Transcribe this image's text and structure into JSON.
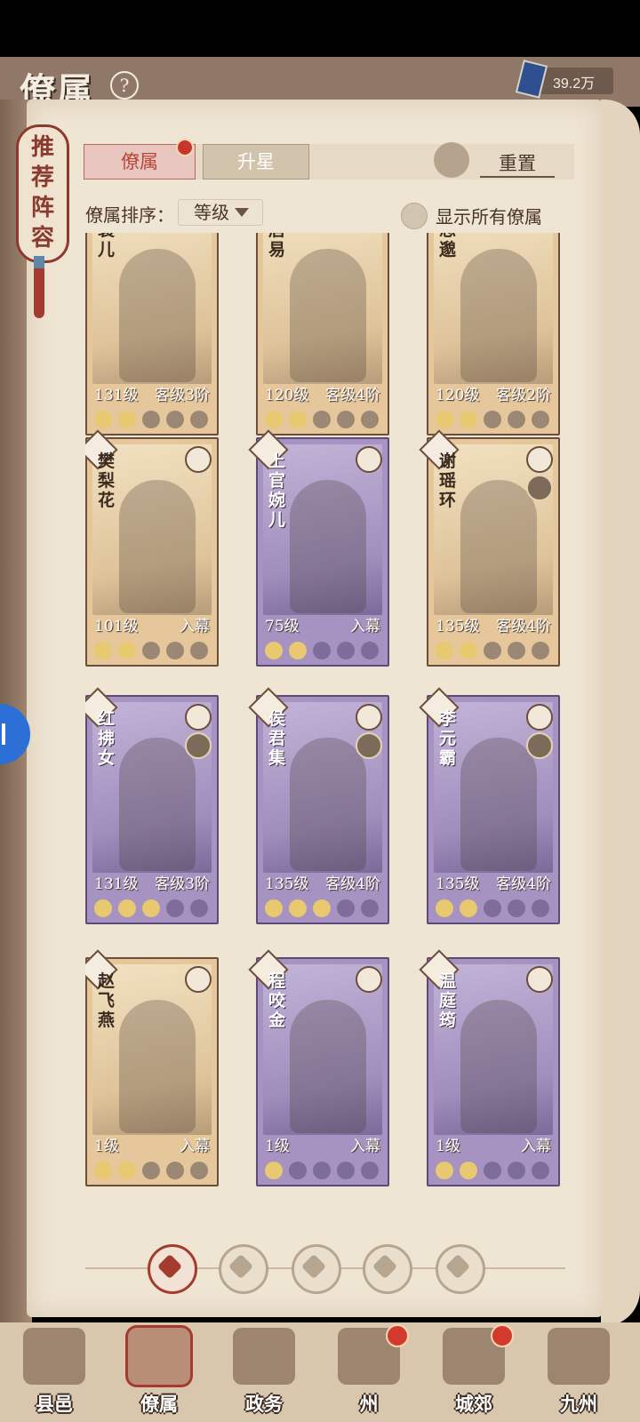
{
  "header": {
    "title": "僚属",
    "help_icon": "question-icon",
    "currency": "39.2万"
  },
  "recommend_tag": {
    "label": "推荐阵容"
  },
  "tabs": [
    {
      "label": "僚属",
      "active": true,
      "has_dot": true
    },
    {
      "label": "升星",
      "active": false
    }
  ],
  "reset": {
    "label": "重置",
    "icon": "refresh-icon"
  },
  "sort": {
    "label": "僚属排序：",
    "value": "等级"
  },
  "show_all": {
    "label": "显示所有僚属",
    "checked": false
  },
  "cards": [
    {
      "name": "襄儿",
      "level": "131级",
      "rank": "客级3阶",
      "moons": 2,
      "tier": "gold"
    },
    {
      "name": "居易",
      "level": "120级",
      "rank": "客级4阶",
      "moons": 2,
      "tier": "gold"
    },
    {
      "name": "思邈",
      "level": "120级",
      "rank": "客级2阶",
      "moons": 2,
      "tier": "gold"
    },
    {
      "name": "樊梨花",
      "level": "101级",
      "rank": "入幕",
      "moons": 2,
      "tier": "gold"
    },
    {
      "name": "上官婉儿",
      "level": "75级",
      "rank": "入幕",
      "moons": 2,
      "tier": "purple"
    },
    {
      "name": "谢瑶环",
      "level": "135级",
      "rank": "客级4阶",
      "moons": 2,
      "tier": "gold"
    },
    {
      "name": "红拂女",
      "level": "131级",
      "rank": "客级3阶",
      "moons": 3,
      "tier": "purple"
    },
    {
      "name": "侯君集",
      "level": "135级",
      "rank": "客级4阶",
      "moons": 3,
      "tier": "purple"
    },
    {
      "name": "李元霸",
      "level": "135级",
      "rank": "客级4阶",
      "moons": 2,
      "tier": "purple"
    },
    {
      "name": "赵飞燕",
      "level": "1级",
      "rank": "入幕",
      "moons": 2,
      "tier": "gold"
    },
    {
      "name": "程咬金",
      "level": "1级",
      "rank": "入幕",
      "moons": 1,
      "tier": "purple"
    },
    {
      "name": "温庭筠",
      "level": "1级",
      "rank": "入幕",
      "moons": 2,
      "tier": "purple"
    }
  ],
  "filters": [
    "all-icon",
    "official-icon",
    "gourd-icon",
    "fan-icon",
    "lion-icon"
  ],
  "bottom_nav": [
    {
      "label": "县邑",
      "active": false,
      "dot": false
    },
    {
      "label": "僚属",
      "active": true,
      "dot": false
    },
    {
      "label": "政务",
      "active": false,
      "dot": false
    },
    {
      "label": "州",
      "active": false,
      "dot": true
    },
    {
      "label": "城郊",
      "active": false,
      "dot": true
    },
    {
      "label": "九州",
      "active": false,
      "dot": false
    }
  ],
  "colors": {
    "accent": "#a33b2f",
    "gold_card": "#e5c79b",
    "purple_card": "#a693c2"
  }
}
